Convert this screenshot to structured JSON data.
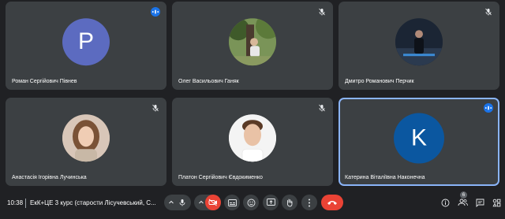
{
  "participants": [
    {
      "name": "Роман Сергійович Півнев",
      "avatar_letter": "P",
      "avatar_color": "#5c6bc0",
      "status": "speaking"
    },
    {
      "name": "Олег Васильович Ганяк",
      "avatar_letter": "",
      "avatar_color": "#4e6a3a",
      "status": "muted"
    },
    {
      "name": "Дмитро Романович Перчик",
      "avatar_letter": "",
      "avatar_color": "#1f2c3c",
      "status": "muted"
    },
    {
      "name": "Анастасія Ігорівна Лучинська",
      "avatar_letter": "",
      "avatar_color": "#c9b3a3",
      "status": "muted"
    },
    {
      "name": "Платон Сергійович Євдокименко",
      "avatar_letter": "",
      "avatar_color": "#f1f1f1",
      "status": "muted"
    },
    {
      "name": "Катерина Віталіївна Наконечна",
      "avatar_letter": "K",
      "avatar_color": "#0b57a0",
      "status": "speaking"
    }
  ],
  "bottom_bar": {
    "time": "10:38",
    "meeting_title": "ЕкК+ЦЕ 3 курс (старости Лісучевський, С...",
    "participant_count": "6"
  },
  "colors": {
    "background": "#202124",
    "tile": "#3c4043",
    "accent": "#1a73e8",
    "end_call": "#ea4335",
    "active_border": "#8ab4f8"
  }
}
